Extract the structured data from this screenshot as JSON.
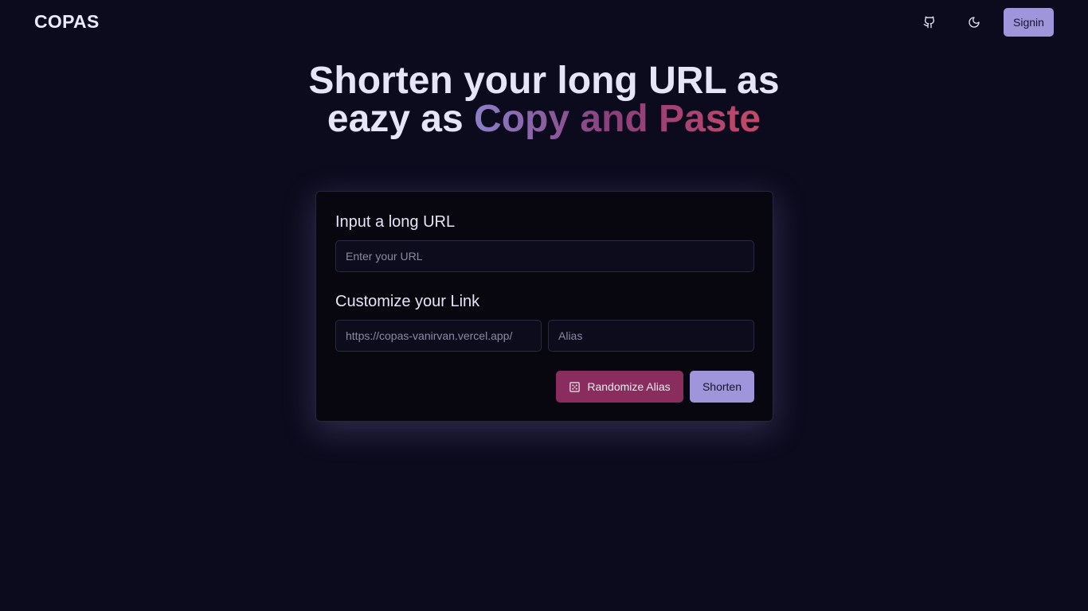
{
  "header": {
    "logo": "COPAS",
    "signin_label": "Signin"
  },
  "hero": {
    "line1": "Shorten your long URL as",
    "line2_prefix": "eazy as ",
    "line2_highlight": "Copy and Paste"
  },
  "form": {
    "url_label": "Input a long URL",
    "url_placeholder": "Enter your URL",
    "url_value": "",
    "customize_label": "Customize your Link",
    "base_url": "https://copas-vanirvan.vercel.app/",
    "alias_placeholder": "Alias",
    "alias_value": "",
    "randomize_label": "Randomize Alias",
    "shorten_label": "Shorten"
  },
  "icons": {
    "github": "github-icon",
    "theme": "moon-icon",
    "dice": "dice-icon"
  },
  "colors": {
    "background": "#0c0b1d",
    "accent": "#9f95db",
    "randomize": "#882d5d",
    "gradient_start": "#8d7fc9",
    "gradient_end": "#c54868"
  }
}
